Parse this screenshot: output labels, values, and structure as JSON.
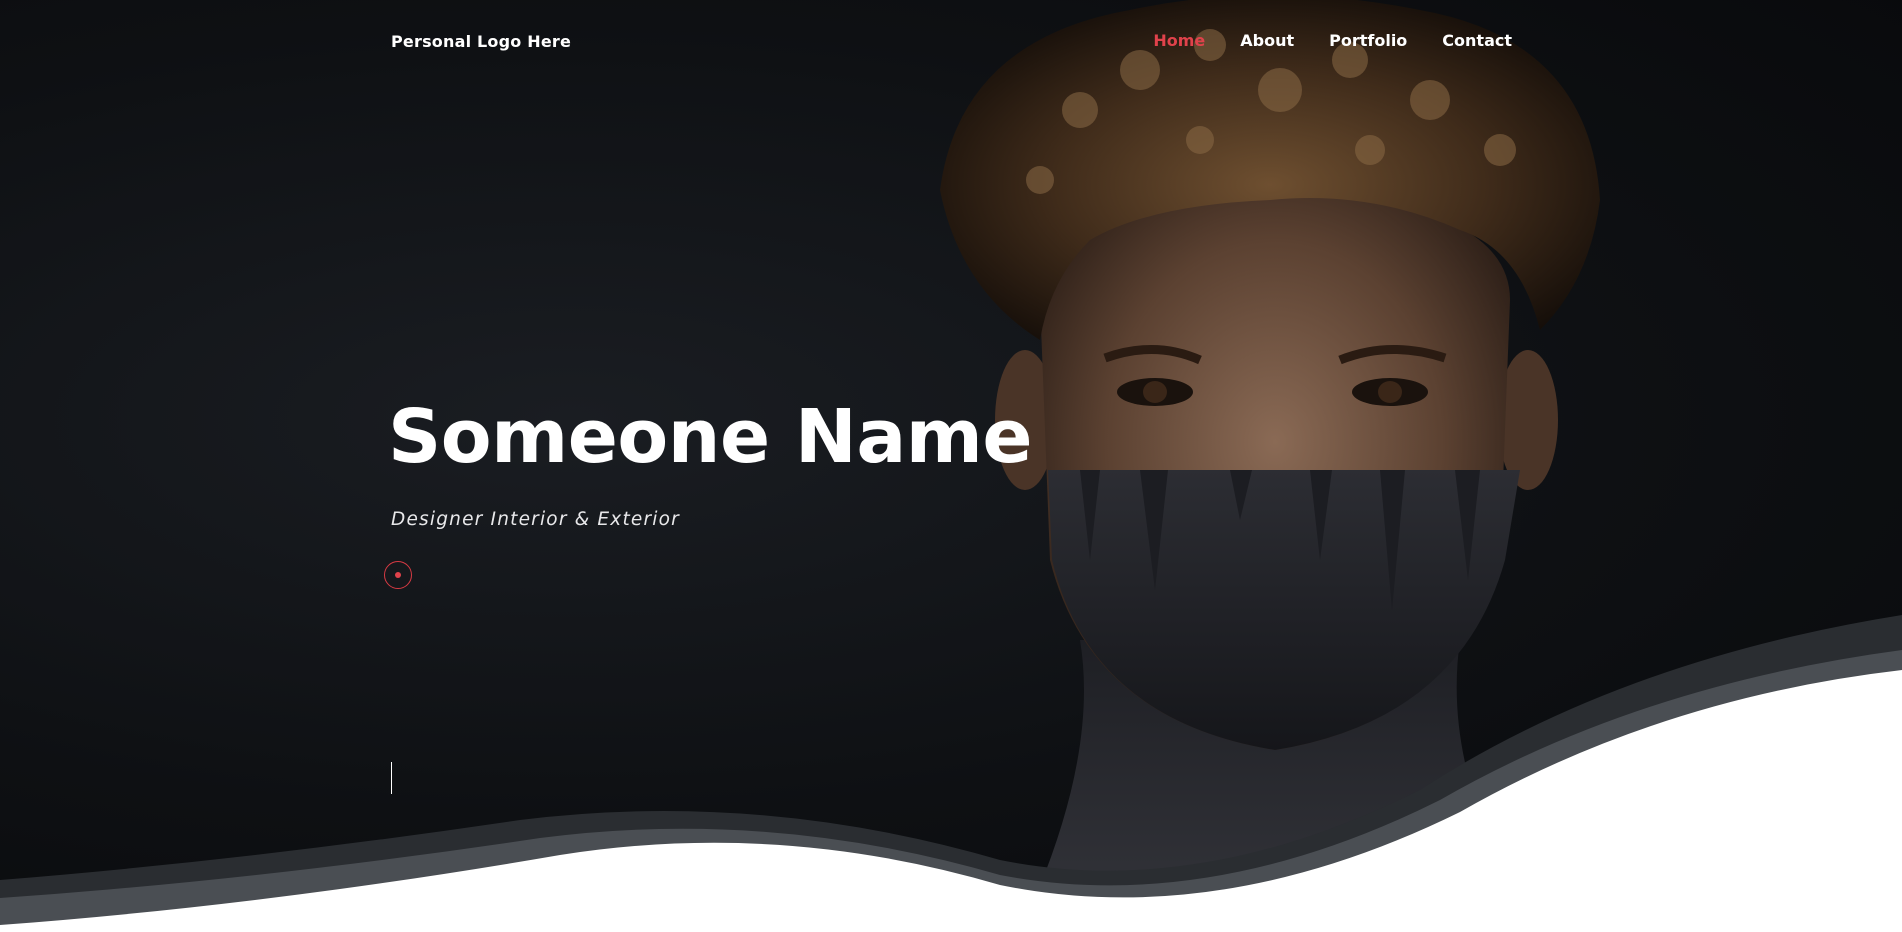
{
  "nav": {
    "logo": "Personal Logo Here",
    "items": [
      {
        "label": "Home",
        "active": true
      },
      {
        "label": "About",
        "active": false
      },
      {
        "label": "Portfolio",
        "active": false
      },
      {
        "label": "Contact",
        "active": false
      }
    ]
  },
  "hero": {
    "title": "Someone Name",
    "subtitle": "Designer Interior & Exterior",
    "play_icon": "play-circle-icon",
    "scroll_icon": "scroll-line-indicator"
  },
  "colors": {
    "accent": "#e0424b",
    "background": "#0e1013",
    "text": "#ffffff",
    "wave_dark": "#2a2d31",
    "wave_mid": "#4a4e53",
    "page": "#ffffff"
  }
}
